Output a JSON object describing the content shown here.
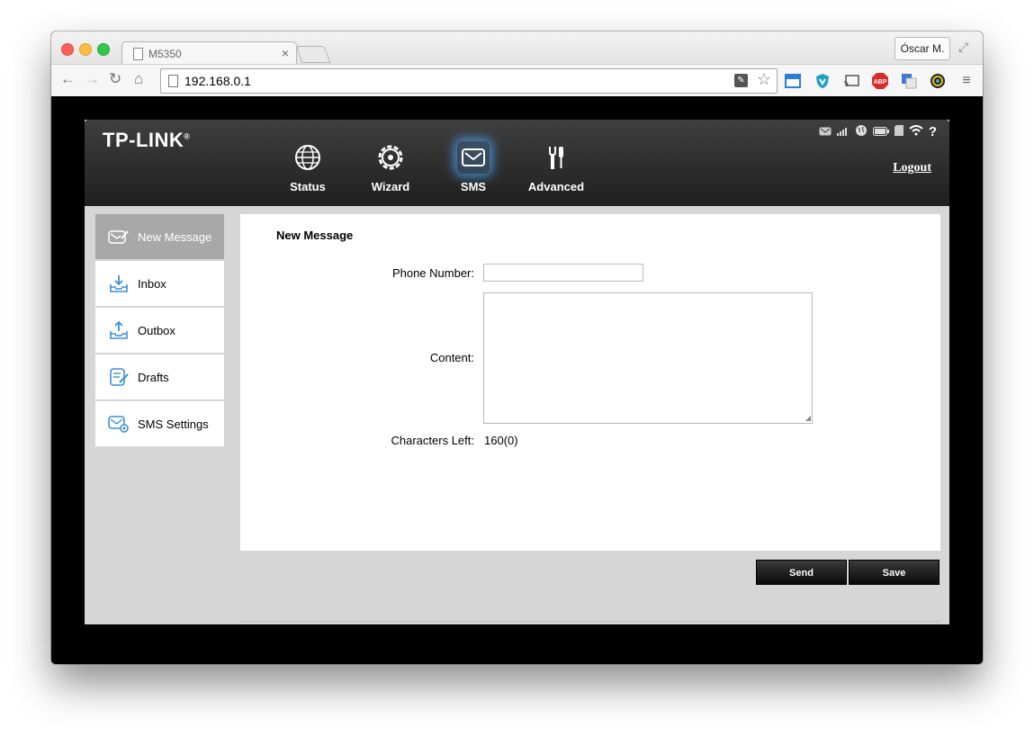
{
  "browser": {
    "tab_title": "M5350",
    "tab_close": "×",
    "profile_name": "Óscar M.",
    "url": "192.168.0.1",
    "extensions": [
      "tab-manager-icon",
      "shield-icon",
      "cast-icon",
      "adblock-icon",
      "translate-icon",
      "color-picker-icon",
      "menu-icon"
    ],
    "abp_label": "ABP"
  },
  "router": {
    "brand": "TP-LINK",
    "brand_mark": "®",
    "nav": [
      {
        "label": "Status",
        "icon": "globe-icon"
      },
      {
        "label": "Wizard",
        "icon": "gear-icon"
      },
      {
        "label": "SMS",
        "icon": "envelope-icon",
        "active": true
      },
      {
        "label": "Advanced",
        "icon": "tools-icon"
      }
    ],
    "logout": "Logout",
    "status_help": "?"
  },
  "sidebar": {
    "items": [
      {
        "label": "New Message",
        "icon": "compose-icon",
        "active": true
      },
      {
        "label": "Inbox",
        "icon": "inbox-icon"
      },
      {
        "label": "Outbox",
        "icon": "outbox-icon"
      },
      {
        "label": "Drafts",
        "icon": "drafts-icon"
      },
      {
        "label": "SMS Settings",
        "icon": "sms-settings-icon"
      }
    ]
  },
  "form": {
    "title": "New Message",
    "phone_label": "Phone Number:",
    "phone_value": "",
    "content_label": "Content:",
    "content_value": "",
    "chars_label": "Characters Left:",
    "chars_value": "160(0)"
  },
  "actions": {
    "send": "Send",
    "save": "Save"
  },
  "colors": {
    "header": "#2a2a2a",
    "active_sidebar": "#a8a8a8",
    "accent_blue": "#3d8fd6"
  }
}
